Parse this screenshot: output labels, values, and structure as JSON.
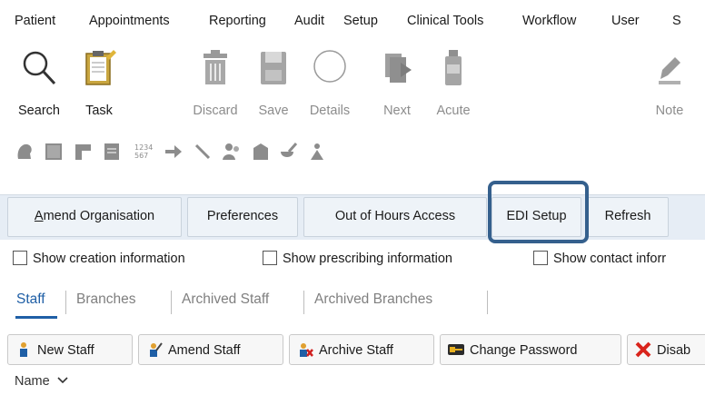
{
  "menubar": {
    "items": [
      {
        "label": "Patient"
      },
      {
        "label": "Appointments"
      },
      {
        "label": "Reporting"
      },
      {
        "label": "Audit"
      },
      {
        "label": "Setup"
      },
      {
        "label": "Clinical Tools"
      },
      {
        "label": "Workflow"
      },
      {
        "label": "User"
      },
      {
        "label": "S"
      }
    ]
  },
  "toolbar": {
    "items": [
      {
        "label": "Search",
        "icon": "magnifier-icon"
      },
      {
        "label": "Task",
        "icon": "clipboard-icon"
      },
      {
        "label": "Discard",
        "icon": "trash-icon"
      },
      {
        "label": "Save",
        "icon": "floppy-icon"
      },
      {
        "label": "Details",
        "icon": "circle-icon"
      },
      {
        "label": "Next",
        "icon": "next-document-icon"
      },
      {
        "label": "Acute",
        "icon": "medicine-bottle-icon"
      },
      {
        "label": "Note",
        "icon": "pen-note-icon"
      }
    ]
  },
  "org_tabs": {
    "items": [
      {
        "label_first": "A",
        "label_rest": "mend Organisation"
      },
      {
        "label": "Preferences"
      },
      {
        "label": "Out of Hours Access"
      },
      {
        "label": "EDI Setup"
      },
      {
        "label": "Refresh"
      }
    ],
    "highlight_color": "#35608d"
  },
  "options": {
    "show_creation": "Show creation information",
    "show_prescribing": "Show prescribing information",
    "show_contact": "Show contact inforr"
  },
  "subtabs": {
    "items": [
      "Staff",
      "Branches",
      "Archived Staff",
      "Archived Branches"
    ],
    "active": "Staff",
    "active_color": "#1f5fa6"
  },
  "actions": {
    "new_staff": "New Staff",
    "amend_staff": "Amend Staff",
    "archive_staff": "Archive Staff",
    "change_password": "Change Password",
    "disable": "Disab"
  },
  "table": {
    "column_name": "Name",
    "sort_icon": "chevron-down-icon"
  }
}
